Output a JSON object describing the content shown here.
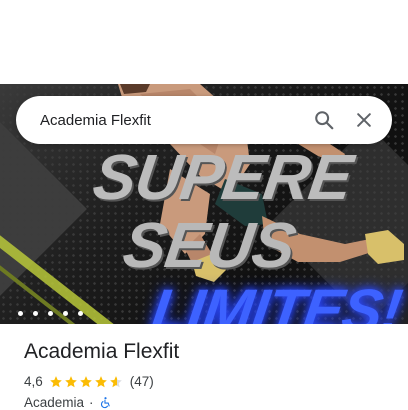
{
  "search": {
    "query": "Academia Flexfit",
    "search_icon": "search-icon",
    "close_icon": "close-icon"
  },
  "hero": {
    "line1": "SUPERE",
    "line2": "SEUS",
    "line3": "LIMITES!",
    "slide_count": 5
  },
  "place": {
    "name": "Academia Flexfit",
    "rating": "4,6",
    "stars_value": 4.6,
    "reviews": "(47)",
    "category": "Academia",
    "separator": "·",
    "accessibility_icon": "wheelchair-accessible-icon"
  },
  "colors": {
    "star": "#fbbc04",
    "accent_blue": "#3d62ff",
    "lime": "#b8c83a"
  }
}
